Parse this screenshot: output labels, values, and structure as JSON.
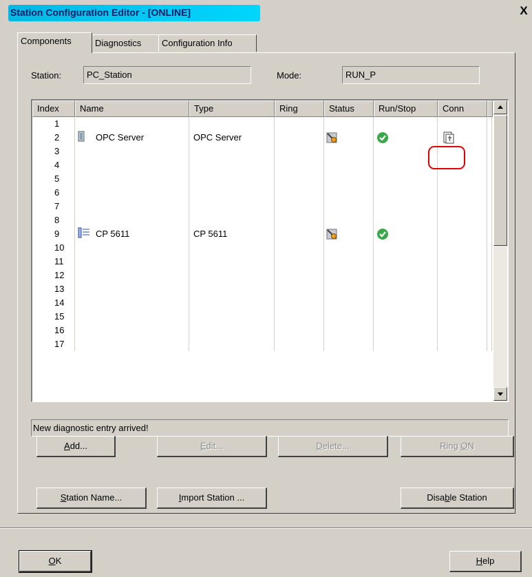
{
  "window": {
    "title": "Station Configuration Editor - [ONLINE]",
    "close_label": "X"
  },
  "tabs": [
    {
      "label": "Components",
      "active": true
    },
    {
      "label": "Diagnostics",
      "active": false
    },
    {
      "label": "Configuration Info",
      "active": false
    }
  ],
  "station": {
    "label": "Station:",
    "value": "PC_Station"
  },
  "mode": {
    "label": "Mode:",
    "value": "RUN_P"
  },
  "table": {
    "columns": [
      "Index",
      "Name",
      "Type",
      "Ring",
      "Status",
      "Run/Stop",
      "Conn"
    ],
    "rows": [
      {
        "index": "1",
        "name": "",
        "type": ""
      },
      {
        "index": "2",
        "name": "OPC Server",
        "type": "OPC Server",
        "icon": "opc-server-icon",
        "status_icon": "diagnostic-status-icon",
        "run_icon": "run-ok-icon",
        "conn_icon": "connection-icon"
      },
      {
        "index": "3",
        "name": "",
        "type": ""
      },
      {
        "index": "4",
        "name": "",
        "type": ""
      },
      {
        "index": "5",
        "name": "",
        "type": ""
      },
      {
        "index": "6",
        "name": "",
        "type": ""
      },
      {
        "index": "7",
        "name": "",
        "type": ""
      },
      {
        "index": "8",
        "name": "",
        "type": ""
      },
      {
        "index": "9",
        "name": "CP 5611",
        "type": "CP 5611",
        "icon": "cp-card-icon",
        "status_icon": "diagnostic-status-icon",
        "run_icon": "run-ok-icon"
      },
      {
        "index": "10",
        "name": "",
        "type": ""
      },
      {
        "index": "11",
        "name": "",
        "type": ""
      },
      {
        "index": "12",
        "name": "",
        "type": ""
      },
      {
        "index": "13",
        "name": "",
        "type": ""
      },
      {
        "index": "14",
        "name": "",
        "type": ""
      },
      {
        "index": "15",
        "name": "",
        "type": ""
      },
      {
        "index": "16",
        "name": "",
        "type": ""
      },
      {
        "index": "17",
        "name": "",
        "type": ""
      }
    ]
  },
  "status_message": "New diagnostic entry arrived!",
  "buttons": {
    "add": {
      "pre": "",
      "key": "A",
      "post": "dd..."
    },
    "edit": {
      "pre": "",
      "key": "E",
      "post": "dit..."
    },
    "delete": {
      "pre": "",
      "key": "D",
      "post": "elete..."
    },
    "ring_on": {
      "pre": "Ring ",
      "key": "O",
      "post": "N"
    },
    "station_name": {
      "pre": "",
      "key": "S",
      "post": "tation Name..."
    },
    "import_station": {
      "pre": "",
      "key": "I",
      "post": "mport Station ..."
    },
    "disable_station": {
      "pre": "Disa",
      "key": "b",
      "post": "le Station"
    },
    "ok": {
      "pre": "",
      "key": "O",
      "post": "K"
    },
    "help": {
      "pre": "",
      "key": "H",
      "post": "elp"
    }
  },
  "colors": {
    "dialog_bg": "#d4d0c8",
    "title_bg": "#00c8f0",
    "highlight_ring": "#e00000",
    "ok_green": "#3aa84a"
  }
}
